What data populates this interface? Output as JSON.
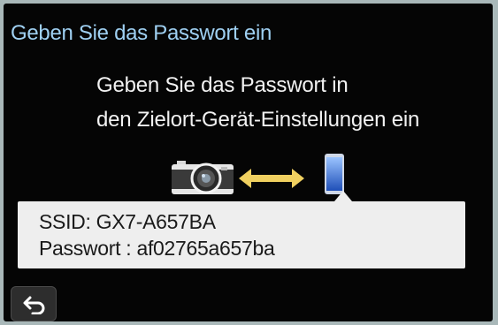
{
  "header": {
    "title": "Geben Sie das Passwort ein"
  },
  "message": {
    "line1": "Geben Sie das Passwort in",
    "line2": "den Zielort-Gerät-Einstellungen ein"
  },
  "icons": {
    "camera": "camera-icon",
    "connection": "double-arrow-icon",
    "phone": "smartphone-icon",
    "back": "return-icon"
  },
  "credentials": {
    "ssid_line": "SSID: GX7-A657BA",
    "password_line": "Passwort : af02765a657ba"
  },
  "colors": {
    "title": "#9fd0f2",
    "arrow": "#f0d060",
    "phone": "#2f6fd8",
    "info_box": "#eeeeee"
  }
}
